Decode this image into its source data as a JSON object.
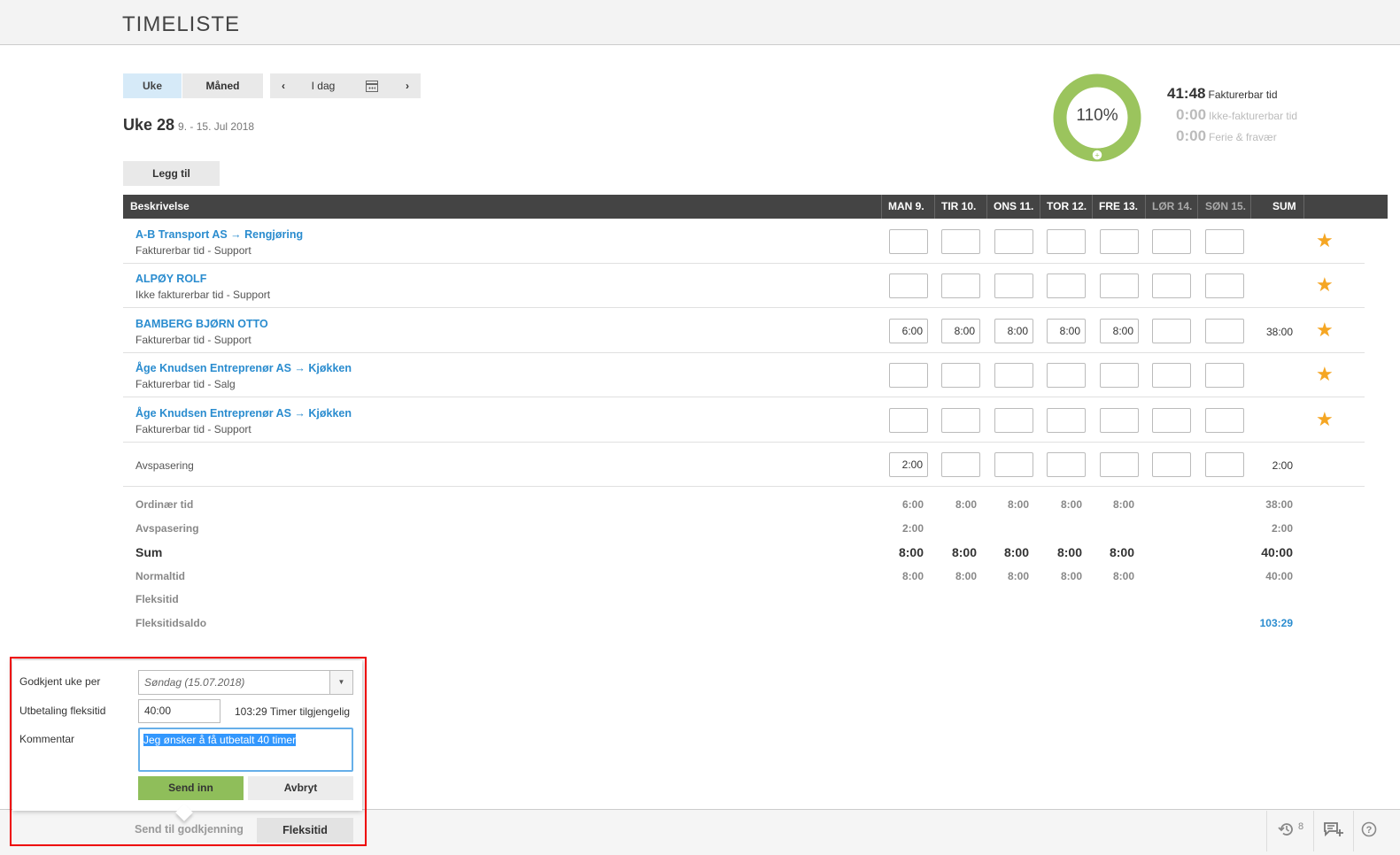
{
  "header": {
    "title": "TIMELISTE"
  },
  "view_toggle": {
    "week": "Uke",
    "month": "Måned"
  },
  "nav": {
    "prev": "‹",
    "today": "I dag",
    "next": "›"
  },
  "period": {
    "title": "Uke 28",
    "range": "9. - 15. Jul 2018"
  },
  "add_button": "Legg til",
  "summary": {
    "percent": "110%",
    "percent_value": 1.1,
    "billable": {
      "value": "41:48",
      "label": "Fakturerbar tid"
    },
    "non_billable": {
      "value": "0:00",
      "label": "Ikke-fakturerbar tid"
    },
    "vacation": {
      "value": "0:00",
      "label": "Ferie & fravær"
    },
    "ring_color": "#9bc45d"
  },
  "table": {
    "columns": [
      "Beskrivelse",
      "MAN 9.",
      "TIR 10.",
      "ONS 11.",
      "TOR 12.",
      "FRE 13.",
      "LØR 14.",
      "SØN 15.",
      "SUM"
    ],
    "rows": [
      {
        "title": "A-B Transport AS → Rengjøring",
        "sub": "Fakturerbar tid - Support",
        "cells": [
          "",
          "",
          "",
          "",
          "",
          "",
          ""
        ],
        "sum": ""
      },
      {
        "title": "ALPØY ROLF",
        "sub": "Ikke fakturerbar tid - Support",
        "cells": [
          "",
          "",
          "",
          "",
          "",
          "",
          ""
        ],
        "sum": ""
      },
      {
        "title": "BAMBERG BJØRN OTTO",
        "sub": "Fakturerbar tid - Support",
        "cells": [
          "6:00",
          "8:00",
          "8:00",
          "8:00",
          "8:00",
          "",
          ""
        ],
        "sum": "38:00"
      },
      {
        "title": "Åge Knudsen Entreprenør AS → Kjøkken",
        "sub": "Fakturerbar tid - Salg",
        "cells": [
          "",
          "",
          "",
          "",
          "",
          "",
          ""
        ],
        "sum": ""
      },
      {
        "title": "Åge Knudsen Entreprenør AS → Kjøkken",
        "sub": "Fakturerbar tid - Support",
        "cells": [
          "",
          "",
          "",
          "",
          "",
          "",
          ""
        ],
        "sum": ""
      }
    ],
    "avspasering_row": {
      "label": "Avspasering",
      "cells": [
        "2:00",
        "",
        "",
        "",
        "",
        "",
        ""
      ],
      "sum": "2:00"
    },
    "star_glyph": "★"
  },
  "totals": {
    "ordinaer": {
      "label": "Ordinær tid",
      "values": [
        "6:00",
        "8:00",
        "8:00",
        "8:00",
        "8:00"
      ],
      "sum": "38:00"
    },
    "avspasering": {
      "label": "Avspasering",
      "values": [
        "2:00",
        "",
        "",
        "",
        ""
      ],
      "sum": "2:00"
    },
    "sum": {
      "label": "Sum",
      "values": [
        "8:00",
        "8:00",
        "8:00",
        "8:00",
        "8:00"
      ],
      "sum": "40:00"
    },
    "normaltid": {
      "label": "Normaltid",
      "values": [
        "8:00",
        "8:00",
        "8:00",
        "8:00",
        "8:00"
      ],
      "sum": "40:00"
    },
    "fleksitid": {
      "label": "Fleksitid",
      "values": [
        "",
        "",
        "",
        "",
        ""
      ],
      "sum": ""
    },
    "fleksitidsaldo": {
      "label": "Fleksitidsaldo",
      "values": [
        "",
        "",
        "",
        "",
        ""
      ],
      "sum": "103:29"
    }
  },
  "popup": {
    "approved_label": "Godkjent uke per",
    "approved_value": "Søndag (15.07.2018)",
    "payout_label": "Utbetaling fleksitid",
    "payout_value": "40:00",
    "available_value": "103:29",
    "available_label": "Timer tilgjengelig",
    "comment_label": "Kommentar",
    "comment_value": "Jeg ønsker å få utbetalt 40 timer",
    "submit": "Send inn",
    "cancel": "Avbryt"
  },
  "footer": {
    "send_for_approval": "Send til godkjenning",
    "flex": "Fleksitid",
    "history_count": "8",
    "history_icon": "history-icon",
    "comment_icon": "comment-add-icon",
    "help_icon": "help-icon"
  }
}
